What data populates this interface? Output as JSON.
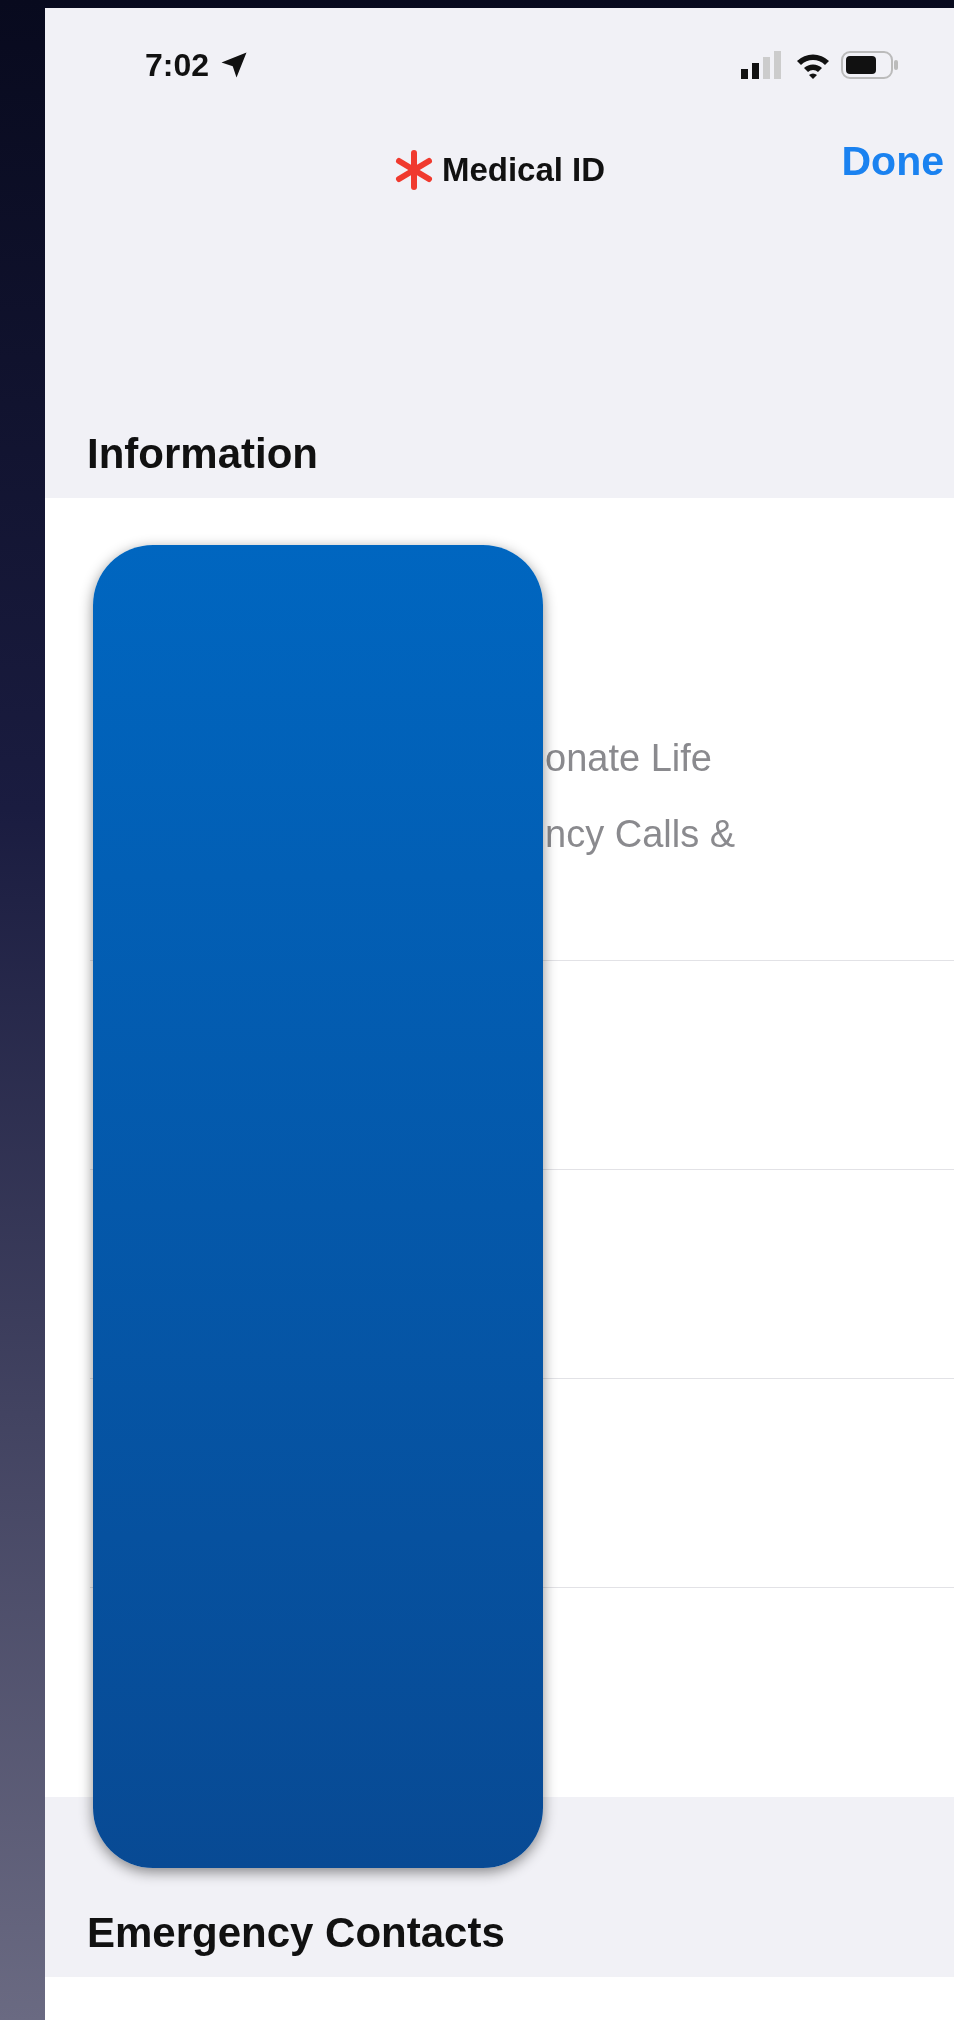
{
  "status_bar": {
    "time": "7:02"
  },
  "nav": {
    "title": "Medical ID",
    "done": "Done"
  },
  "sections": [
    {
      "header": "Information",
      "rows": [
        {
          "lines": [
            "onate Life",
            "ncy Calls &"
          ]
        },
        {
          "lines": []
        },
        {
          "lines": []
        },
        {
          "lines": []
        },
        {
          "lines": []
        }
      ]
    },
    {
      "header": "Emergency Contacts"
    }
  ]
}
